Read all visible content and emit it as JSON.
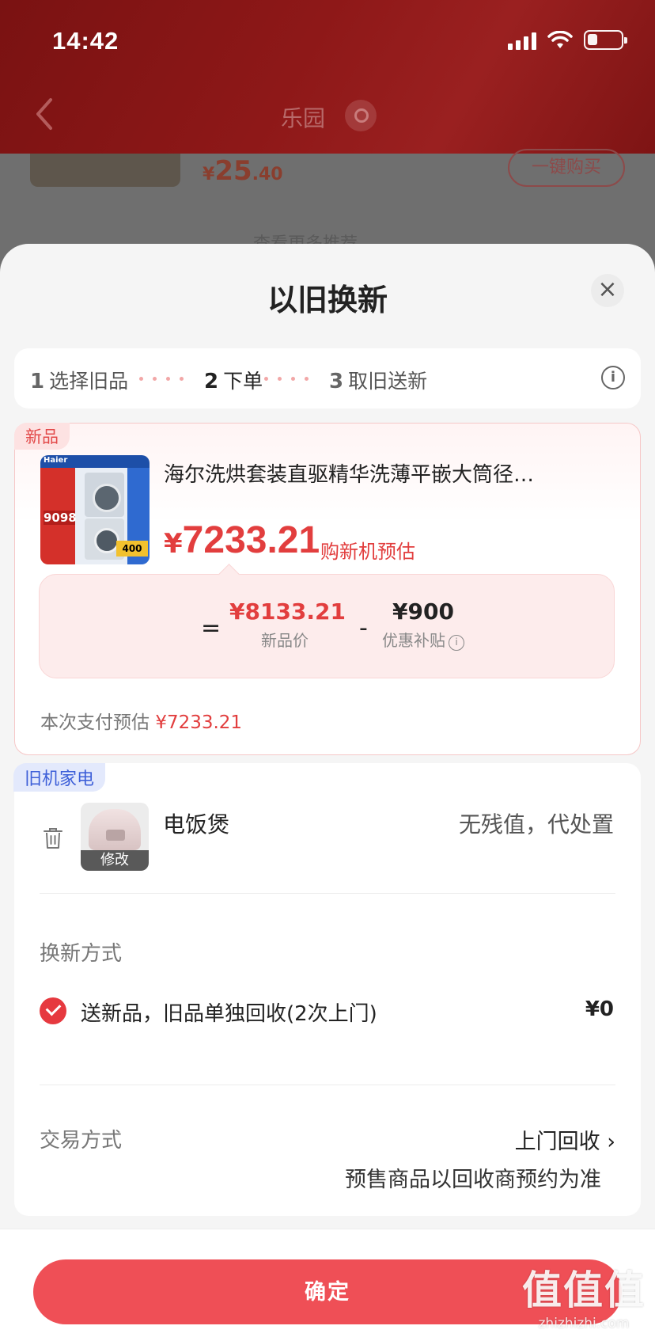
{
  "status_bar": {
    "time": "14:42"
  },
  "nav": {
    "title": "乐园"
  },
  "background": {
    "price_currency": "¥",
    "price_integer": "25",
    "price_decimal": ".40",
    "buy_button": "一键购买",
    "more_link": "查看更多推荐 ⌄"
  },
  "sheet": {
    "title": "以旧换新",
    "close_label": "×",
    "info_label": "i",
    "steps": [
      {
        "num": "1",
        "label": "选择旧品",
        "active": false
      },
      {
        "num": "2",
        "label": "下单",
        "active": true
      },
      {
        "num": "3",
        "label": "取旧送新",
        "active": false
      }
    ]
  },
  "new_product": {
    "tag": "新品",
    "image_brand": "Haier",
    "image_price": "9098",
    "image_badge": "400",
    "name": "海尔洗烘套装直驱精华洗薄平嵌大筒径…",
    "price_currency": "¥",
    "price": "7233.21",
    "price_label": "购新机预估",
    "calc": {
      "equals": "=",
      "minus": "-",
      "new_price": "¥8133.21",
      "new_price_label": "新品价",
      "subsidy": "¥900",
      "subsidy_label": "优惠补贴"
    },
    "pay_estimate_label": "本次支付预估",
    "pay_estimate_value": "¥7233.21"
  },
  "old_appliance": {
    "tag": "旧机家电",
    "modify_label": "修改",
    "name": "电饭煲",
    "value_note": "无残值，代处置",
    "exchange_method_label": "换新方式",
    "exchange_option": "送新品，旧品单独回收(2次上门)",
    "exchange_price": "¥0",
    "trade_method_label": "交易方式",
    "trade_method_value": "上门回收 ›",
    "trade_note": "预售商品以回收商预约为准"
  },
  "bottom": {
    "confirm_label": "确定"
  },
  "watermark": {
    "logo": "值值值",
    "site": "zhizhizhi.com"
  },
  "colors": {
    "accent": "#ef4f56",
    "price_red": "#e23e3e",
    "tag_blue": "#3d5fd8"
  }
}
